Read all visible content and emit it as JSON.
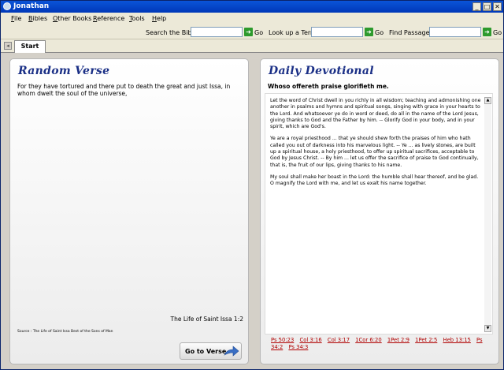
{
  "window": {
    "title": "Jonathan",
    "minimize_glyph": "_",
    "maximize_glyph": "□",
    "close_glyph": "✕"
  },
  "menu": [
    "File",
    "Bibles",
    "Other Books",
    "Reference",
    "Tools",
    "Help"
  ],
  "search": {
    "bible_label": "Search the Bible:",
    "term_label": "Look up a Term:",
    "passages_label": "Find Passages:",
    "go_label": "Go",
    "go_icon": "➜"
  },
  "tabs": {
    "icon_glyph": "◂",
    "start_label": "Start"
  },
  "random_verse": {
    "heading": "Random Verse",
    "text": "For they have tortured and there put to death the great and just Issa, in whom dwelt the soul of the universe,",
    "reference": "The Life of Saint Issa 1:2",
    "source": "Source : The Life of Saint Issa Best of the Sons of Man",
    "button_label": "Go to Verse"
  },
  "daily_devotional": {
    "heading": "Daily Devotional",
    "title": "Whoso offereth praise glorifieth me.",
    "paragraphs": [
      "Let the word of Christ dwell in you richly in all wisdom; teaching and admonishing one another in psalms and hymns and spiritual songs, singing with grace in your hearts to the Lord. And whatsoever ye do in word or deed, do all in the name of the Lord Jesus, giving thanks to God and the Father by him. -- Glorify God in your body, and in your spirit, which are God's.",
      "Ye are a royal priesthood ... that ye should shew forth the praises of him who hath called you out of darkness into his marvelous light. -- Ye ... as lively stones, are built up a spiritual house, a holy priesthood, to offer up spiritual sacrifices, acceptable to God by Jesus Christ. -- By him ... let us offer the sacrifice of praise to God continually, that is, the fruit of our lips, giving thanks to his name.",
      "My soul shall make her boast in the Lord: the humble shall hear thereof, and be glad. O magnify the Lord with me, and let us exalt his name together."
    ],
    "scroll_up": "▲",
    "scroll_down": "▼",
    "links": [
      "Ps 50:23",
      "Col 3:16",
      "Col 3:17",
      "1Cor 6:20",
      "1Pet 2:9",
      "1Pet 2:5",
      "Heb 13:15",
      "Ps 34:2",
      "Ps 34:3"
    ]
  }
}
